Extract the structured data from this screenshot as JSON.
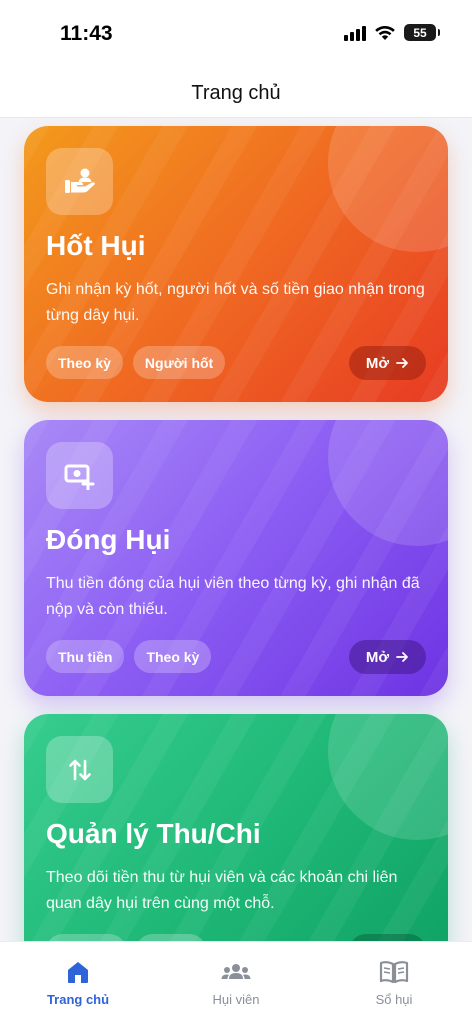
{
  "status_bar": {
    "time": "11:43",
    "battery": "55"
  },
  "header": {
    "title": "Trang chủ"
  },
  "cards": [
    {
      "icon": "hand-receive-icon",
      "title": "Hốt Hụi",
      "description": "Ghi nhận kỳ hốt, người hốt và số tiền giao nhận trong từng dây hụi.",
      "chips": [
        "Theo kỳ",
        "Người hốt"
      ],
      "button": "Mở"
    },
    {
      "icon": "money-add-icon",
      "title": "Đóng Hụi",
      "description": "Thu tiền đóng của hụi viên theo từng kỳ, ghi nhận đã nộp và còn thiếu.",
      "chips": [
        "Thu tiền",
        "Theo kỳ"
      ],
      "button": "Mở"
    },
    {
      "icon": "transfer-arrows-icon",
      "title": "Quản lý Thu/Chi",
      "description": "Theo dõi tiền thu từ hụi viên và các khoản chi liên quan dây hụi trên cùng một chỗ.",
      "chips": [],
      "button": ""
    }
  ],
  "tabs": [
    {
      "label": "Trang chủ",
      "icon": "home-icon",
      "active": true
    },
    {
      "label": "Hụi viên",
      "icon": "people-icon",
      "active": false
    },
    {
      "label": "Sổ hụi",
      "icon": "book-icon",
      "active": false
    }
  ],
  "colors": {
    "accent": "#2f63d8",
    "orange": "#f06a22",
    "purple": "#8b5cf3",
    "green": "#1fb877"
  }
}
